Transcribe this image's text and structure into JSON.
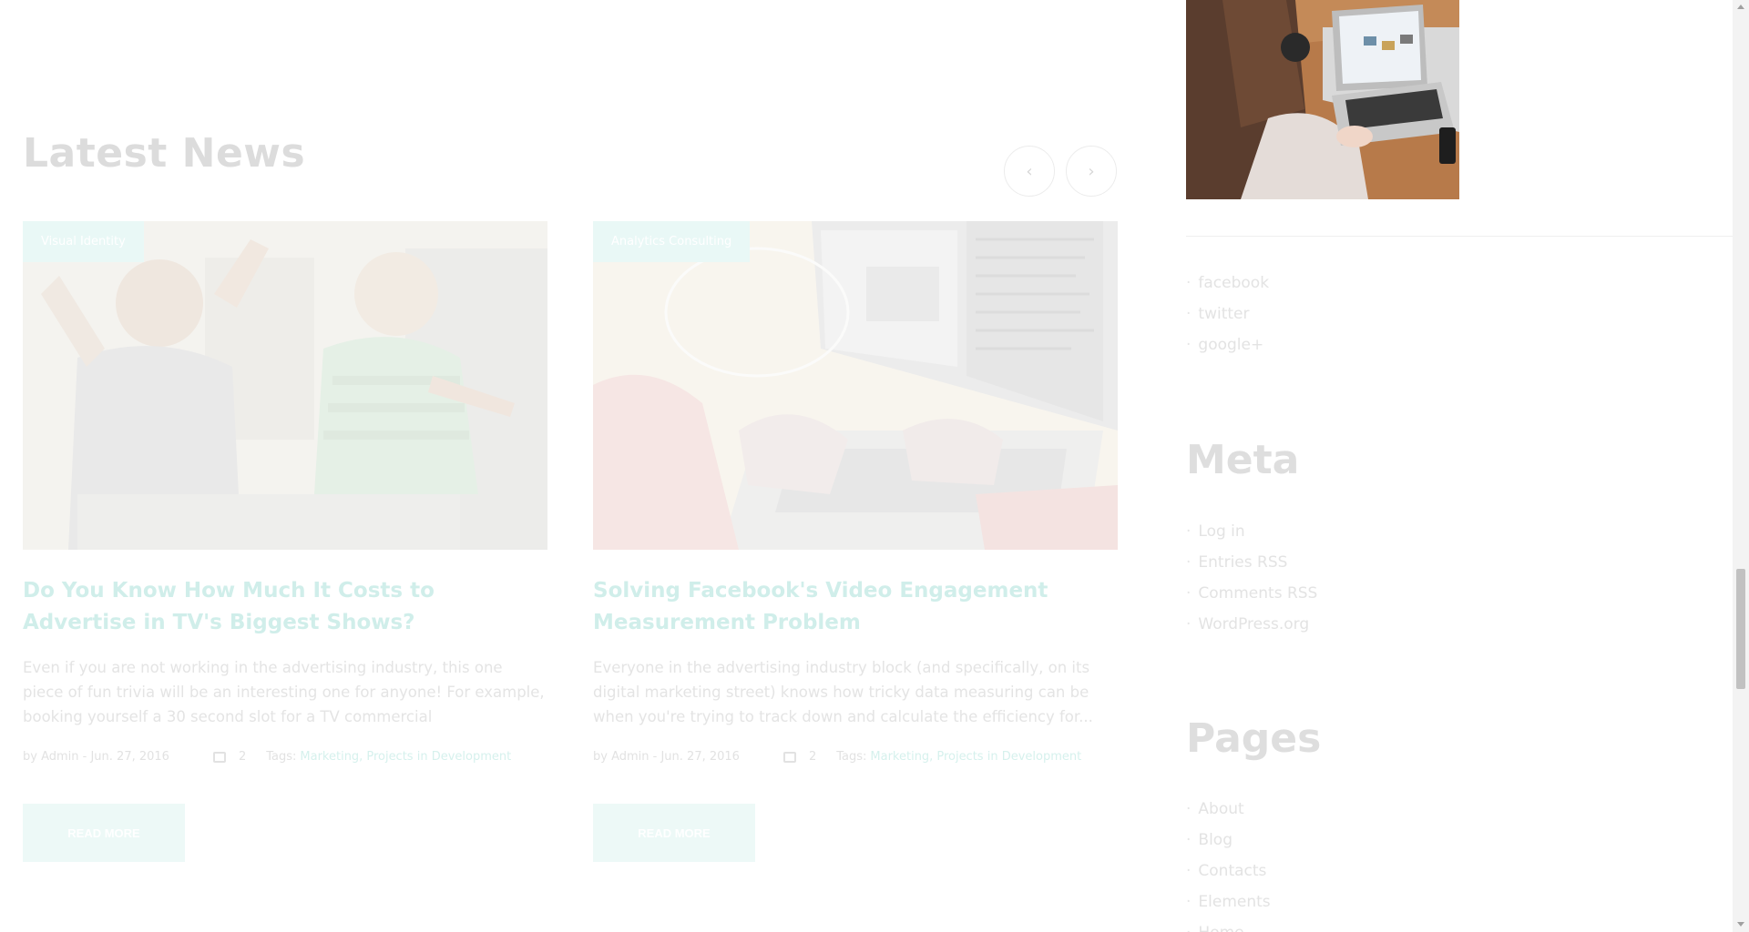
{
  "latest_news": {
    "title": "Latest News",
    "prev_icon": "chevron-left-icon",
    "next_icon": "chevron-right-icon",
    "prev_glyph": "‹",
    "next_glyph": "›"
  },
  "posts": [
    {
      "category": "Visual Identity",
      "title": "Do You Know How Much It Costs to Advertise in TV's Biggest Shows?",
      "excerpt": "Even if you are not working in the advertising industry, this one piece of fun trivia will be an interesting one for anyone! For example, booking yourself a 30 second slot for a TV commercial",
      "author_date": "by Admin - Jun. 27, 2016",
      "comments": "2",
      "tags_label": "Tags:",
      "tags": [
        "Marketing,",
        "Projects in Development"
      ],
      "read_more": "READ MORE"
    },
    {
      "category": "Analytics Consulting",
      "title": "Solving Facebook's Video Engagement Measurement Problem",
      "excerpt": "Everyone in the advertising industry block (and specifically, on its digital marketing street) knows how tricky data measuring can be when you're trying to track down and calculate the efficiency for...",
      "author_date": "by Admin - Jun. 27, 2016",
      "comments": "2",
      "tags_label": "Tags:",
      "tags": [
        "Marketing,",
        "Projects in Development"
      ],
      "read_more": "READ MORE"
    }
  ],
  "sidebar": {
    "social_links": [
      "facebook",
      "twitter",
      "google+"
    ],
    "meta": {
      "title": "Meta",
      "items": [
        "Log in",
        "Entries RSS",
        "Comments RSS",
        "WordPress.org"
      ]
    },
    "pages": {
      "title": "Pages",
      "items": [
        "About",
        "Blog",
        "Contacts",
        "Elements",
        "Home"
      ]
    }
  },
  "colors": {
    "accent_faded": "#d0eeea",
    "badge_bg": "#e9f8f6",
    "button_bg": "#edf9f7"
  }
}
